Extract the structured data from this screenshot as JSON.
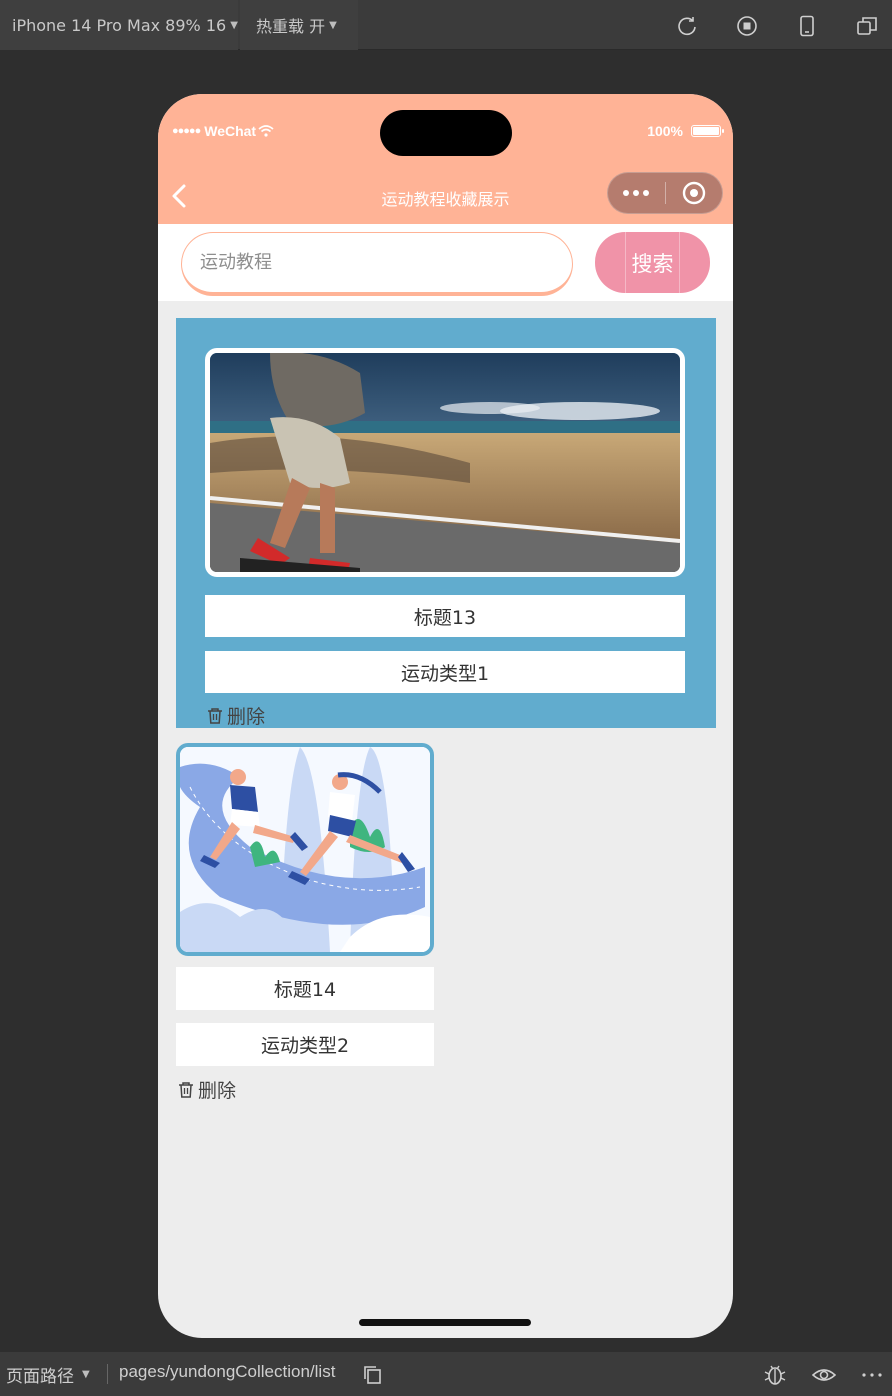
{
  "toolbar": {
    "device_label": "iPhone 14 Pro Max 89% 16",
    "hot_reload_label": "热重载 开"
  },
  "status_bar": {
    "carrier": "WeChat",
    "battery": "100%"
  },
  "nav": {
    "title": "运动教程收藏展示"
  },
  "search": {
    "placeholder": "运动教程",
    "button_label": "搜索"
  },
  "items": [
    {
      "title": "标题13",
      "type": "运动类型1",
      "delete_label": "删除"
    },
    {
      "title": "标题14",
      "type": "运动类型2",
      "delete_label": "删除"
    }
  ],
  "bottom_bar": {
    "path_label": "页面路径",
    "path": "pages/yundongCollection/list"
  },
  "colors": {
    "header": "#ffb396",
    "search_button": "#f093a8",
    "card": "#61acce",
    "page_bg": "#ededed"
  }
}
